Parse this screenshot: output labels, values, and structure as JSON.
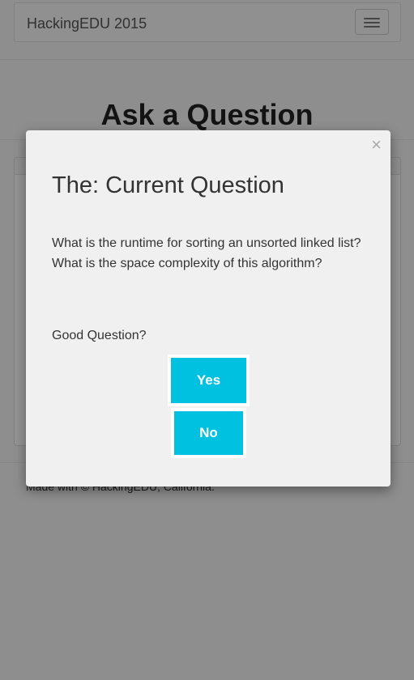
{
  "navbar": {
    "brand": "HackingEDU 2015"
  },
  "page": {
    "title": "Ask a Question"
  },
  "footer": {
    "text": "Made with  © HackingEDU, California."
  },
  "modal": {
    "close_label": "×",
    "title": "The: Current Question",
    "question": "What is the runtime for sorting an unsorted linked list? What is the space complexity of this algorithm?",
    "prompt": "Good Question?",
    "yes_label": "Yes",
    "no_label": "No"
  },
  "colors": {
    "accent": "#00c1e0",
    "backdrop": "#8d8d8d"
  },
  "icons": {
    "menu": "hamburger-icon",
    "close": "close-icon"
  }
}
